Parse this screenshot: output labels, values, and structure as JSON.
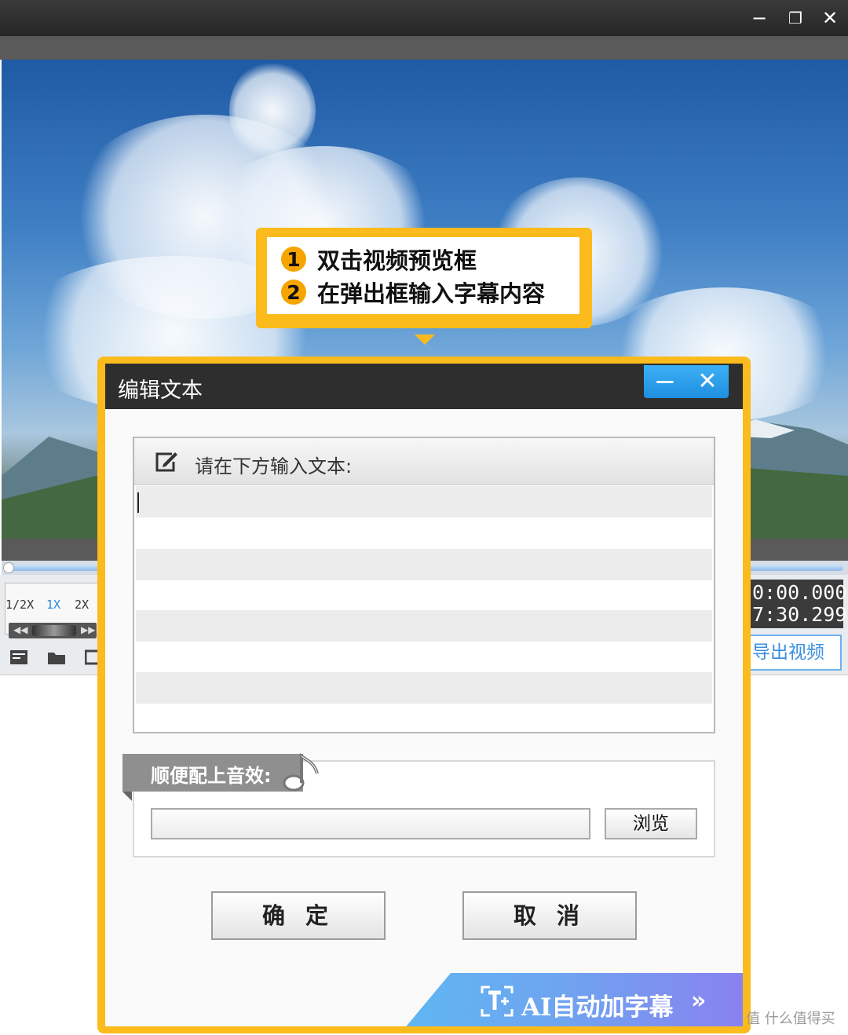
{
  "app": {
    "window_controls": {
      "minimize": "−",
      "restore": "❐",
      "close": "✕"
    },
    "speed": {
      "half": "1/2X",
      "normal": "1X",
      "double": "2X"
    },
    "playback": {
      "rewind": "◀◀",
      "forward": "▶▶"
    },
    "time": {
      "current": "0:00.000",
      "total": "7:30.299"
    },
    "export_label": "导出视频",
    "bottom_icons": [
      "subtitle-icon",
      "folder-icon",
      "clip-icon"
    ]
  },
  "callout": {
    "steps": [
      {
        "num": "1",
        "text": "双击视频预览框"
      },
      {
        "num": "2",
        "text": "在弹出框输入字幕内容"
      }
    ]
  },
  "dialog": {
    "title": "编辑文本",
    "minimize": "−",
    "close": "✕",
    "text_prompt": "请在下方输入文本:",
    "text_value": "",
    "sound_label": "顺便配上音效:",
    "sound_path": "",
    "browse_label": "浏览",
    "ok_label": "确 定",
    "cancel_label": "取 消",
    "ai_label": "AI自动加字幕",
    "ai_chevron": "»"
  },
  "watermark": "值 什么值得买",
  "colors": {
    "accent_yellow": "#fbbb1d",
    "dialog_title_bg": "#2e2e2e",
    "control_blue": "#2b8ad6",
    "ai_banner_start": "#5fb6f2",
    "ai_banner_end": "#8b7ff0"
  }
}
